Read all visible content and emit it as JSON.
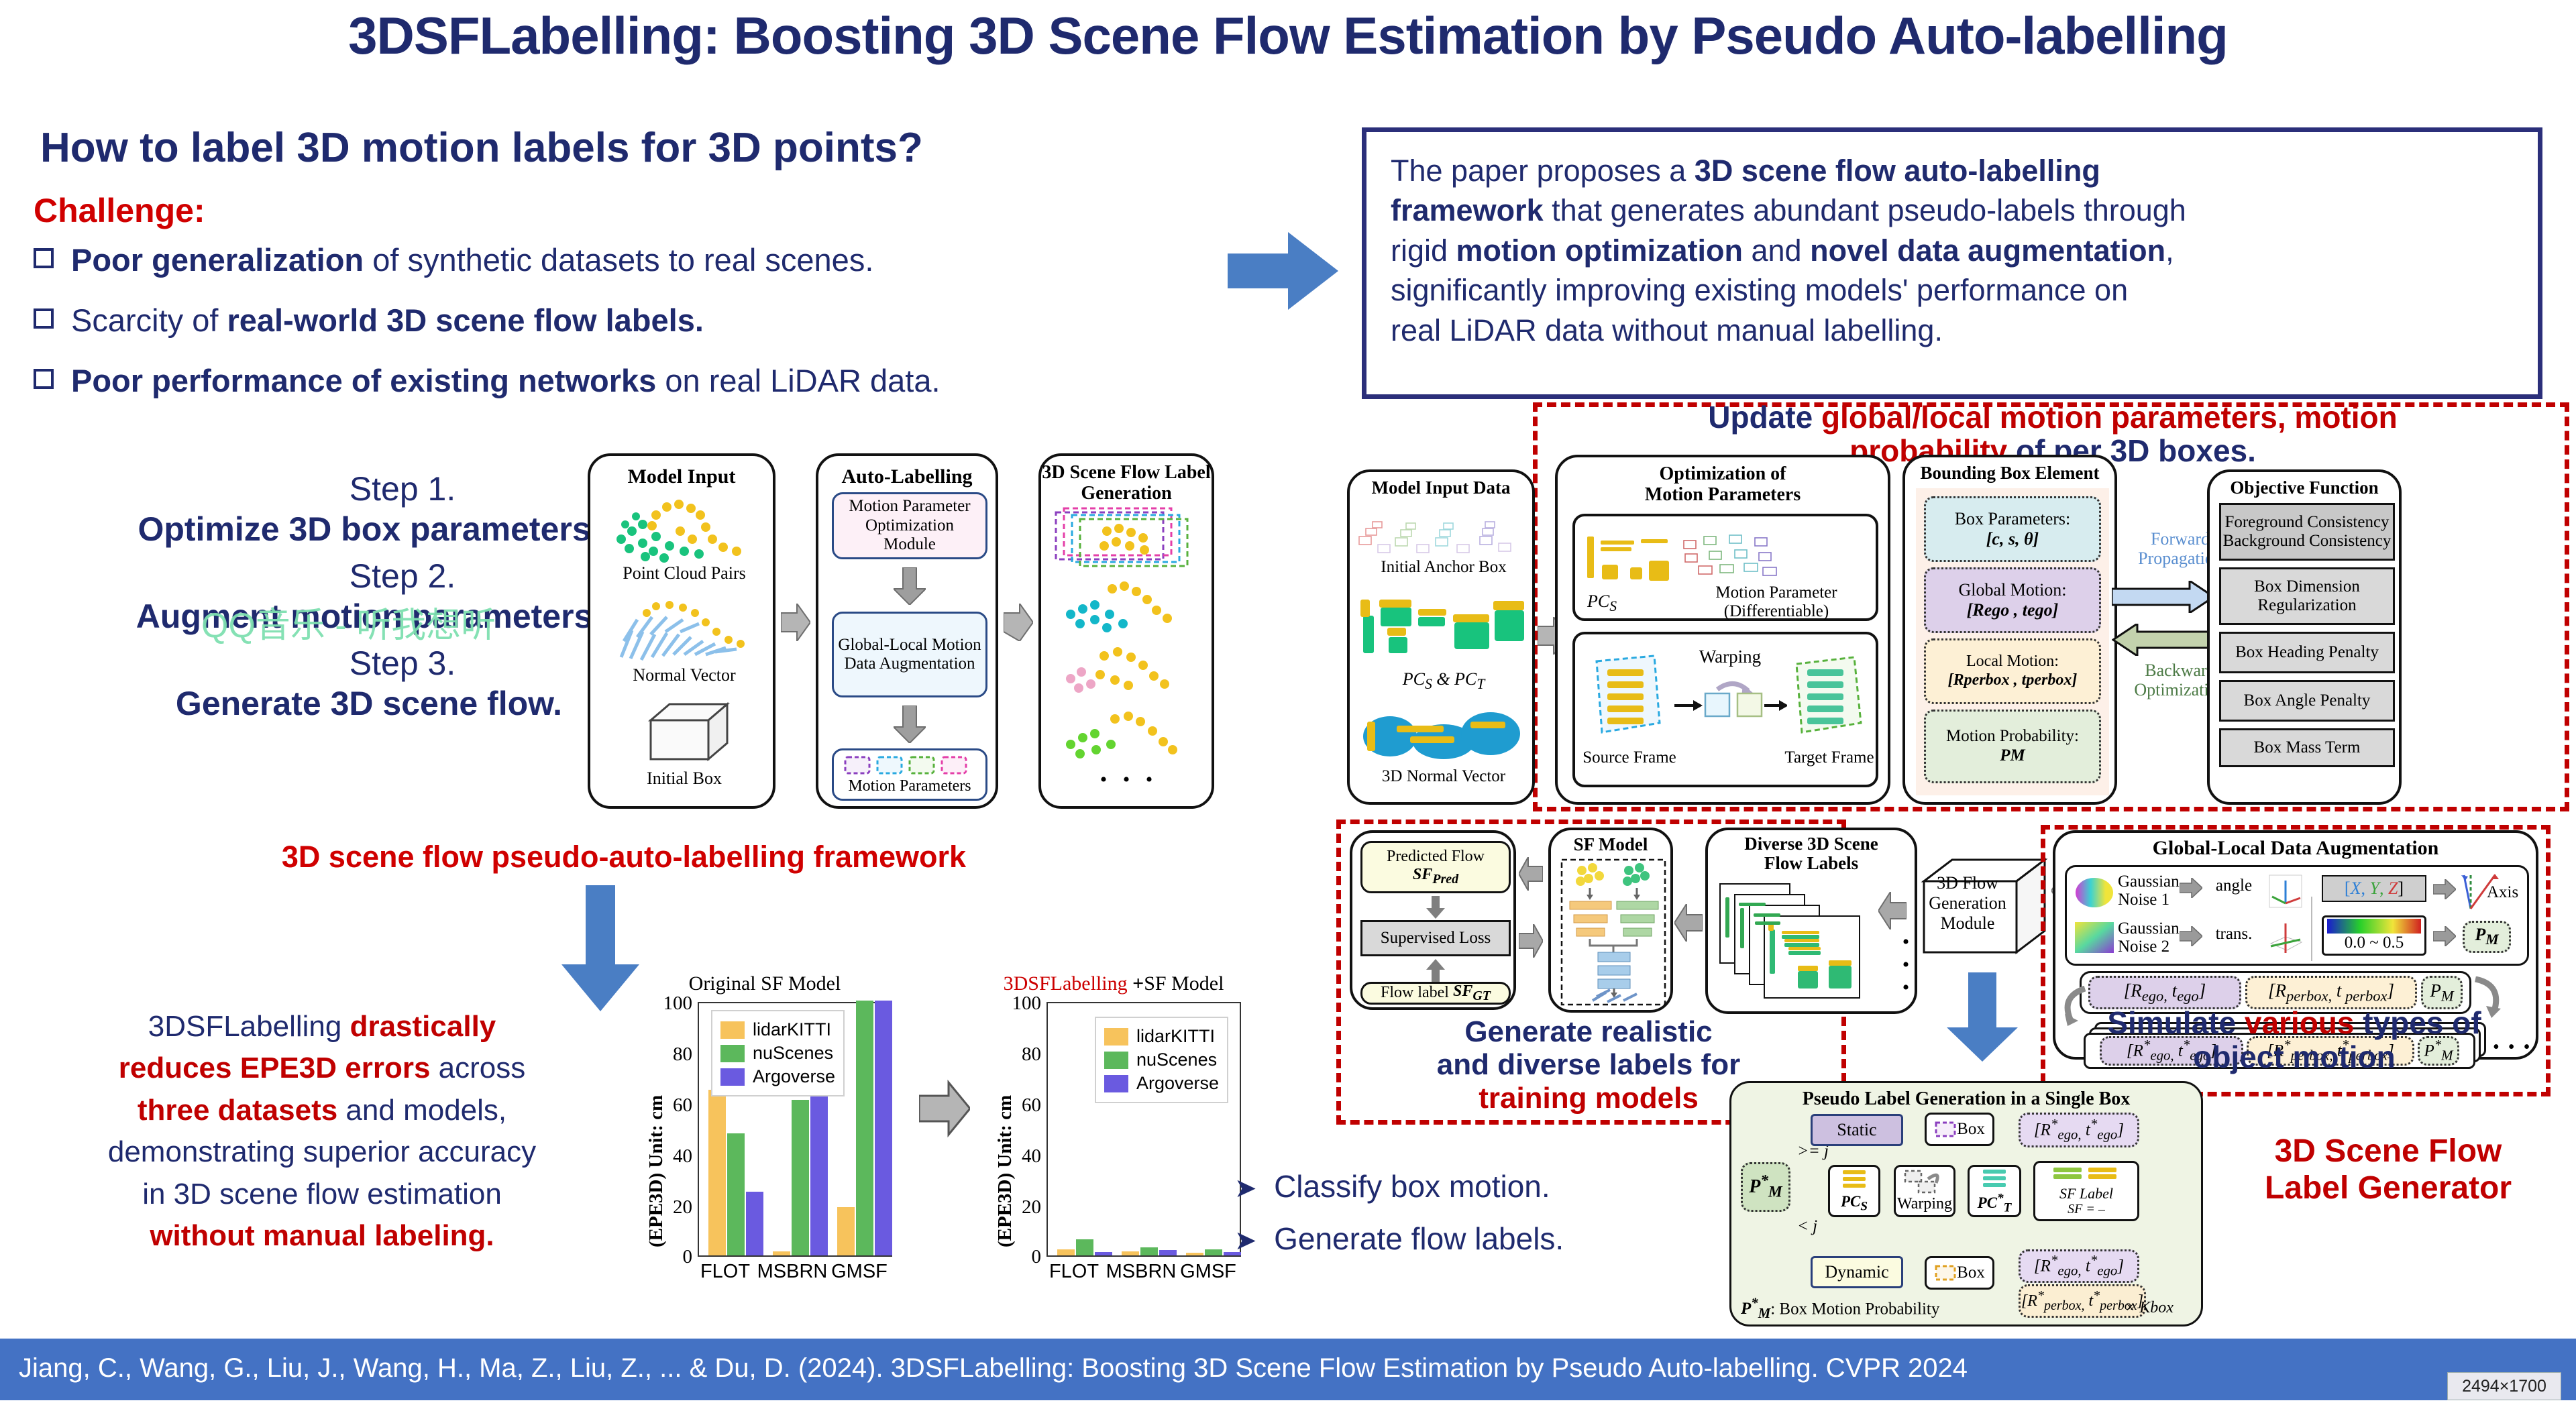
{
  "poster": {
    "title": "3DSFLabelling: Boosting 3D Scene Flow Estimation by Pseudo Auto-labelling",
    "question": "How to label 3D motion labels for 3D points?",
    "challenge_heading": "Challenge:",
    "challenges": [
      {
        "bold": "Poor generalization",
        "rest": " of synthetic datasets to real scenes."
      },
      {
        "bold": "Scarcity of ",
        "rest": "real-world 3D scene flow labels."
      },
      {
        "bold": "Poor performance of existing networks",
        "rest": " on real LiDAR data."
      }
    ],
    "summary": "The paper proposes a 3D scene flow auto-labelling framework that generates abundant pseudo-labels through rigid motion optimization and novel data augmentation, significantly improving existing models' performance on real LiDAR data without manual labelling.",
    "watermark": "QQ音乐 - 听我想听",
    "footer": "Jiang, C., Wang, G., Liu, J., Wang, H., Ma, Z., Liu, Z., ... & Du, D. (2024). 3DSFLabelling: Boosting 3D Scene Flow Estimation by Pseudo Auto-labelling. CVPR 2024",
    "size_badge": "2494×1700"
  },
  "steps": [
    {
      "num": "Step 1.",
      "text": "Optimize 3D box parameters."
    },
    {
      "num": "Step 2.",
      "text": "Augment motion parameters."
    },
    {
      "num": "Step 3.",
      "text": "Generate 3D scene flow."
    }
  ],
  "framework_caption": "3D scene flow pseudo-auto-labelling framework",
  "left_diagram": {
    "panels": [
      {
        "title": "Model Input",
        "captions": [
          "Point Cloud Pairs",
          "Normal Vector",
          "Initial Box"
        ]
      },
      {
        "title": "Auto-Labelling",
        "boxes": [
          "Motion Parameter Optimization Module",
          "Global-Local Motion Data Augmentation"
        ],
        "caption": "Motion Parameters"
      },
      {
        "title": "3D Scene Flow Label Generation",
        "ellipsis": "• • •"
      }
    ]
  },
  "results_text": {
    "l1_a": "3DSFLabelling ",
    "l1_b": "drastically",
    "l2_a": "reduces EPE3D errors",
    "l2_b": " across",
    "l3_a": "three datasets",
    "l3_b": " and models,",
    "l4": "demonstrating superior accuracy",
    "l5": "in 3D scene flow estimation",
    "l6": "without manual labeling."
  },
  "chart_data": [
    {
      "type": "bar",
      "title": "Original SF Model",
      "title_color": "#000000",
      "categories": [
        "FLOT",
        "MSBRN",
        "GMSF"
      ],
      "series": [
        {
          "name": "lidarKITTI",
          "color": "#f7c35c",
          "values": [
            65,
            1.5,
            19
          ]
        },
        {
          "name": "nuScenes",
          "color": "#5aa css",
          "values": [
            48,
            61,
            100
          ]
        },
        {
          "name": "Argoverse",
          "color": "#6a5ae0",
          "values": [
            25,
            71,
            100
          ]
        }
      ],
      "ylabel": "(EPE3D) Unit: cm",
      "yticks": [
        0,
        20,
        40,
        60,
        80,
        100
      ],
      "ylim": [
        0,
        100
      ],
      "legend_position": "upper-left"
    },
    {
      "type": "bar",
      "title_prefix": "3DSFLabelling ",
      "title_plus": "+",
      "title_suffix": "SF Model",
      "title_color": "#cc0000",
      "categories": [
        "FLOT",
        "MSBRN",
        "GMSF"
      ],
      "series": [
        {
          "name": "lidarKITTI",
          "color": "#f7c35c",
          "values": [
            2.2,
            1.6,
            1.1
          ]
        },
        {
          "name": "nuScenes",
          "color": "#5aa css",
          "values": [
            6.2,
            3.0,
            2.2
          ]
        },
        {
          "name": "Argoverse",
          "color": "#6a5ae0",
          "values": [
            1.3,
            1.9,
            1.2
          ]
        }
      ],
      "ylabel": "(EPE3D) Unit: cm",
      "yticks": [
        0,
        20,
        40,
        60,
        80,
        100
      ],
      "ylim": [
        0,
        100
      ],
      "legend_position": "upper-right"
    }
  ],
  "right_diagram": {
    "banner": {
      "w1": "Update ",
      "w2": "global/local motion parameters, motion",
      "w3": "probability",
      "w4": " of per ",
      "w5": "3D boxes."
    },
    "model_input": {
      "title": "Model Input Data",
      "captions": [
        "Initial Anchor Box",
        "PCS & PCT",
        "3D Normal Vector"
      ]
    },
    "optimization": {
      "title_l1": "Optimization of",
      "title_l2": "Motion Parameters",
      "sub1_caption": "PCS",
      "sub1_label_l1": "Motion Parameter",
      "sub1_label_l2": "(Differentiable)",
      "warping": "Warping",
      "source": "Source Frame",
      "target": "Target Frame"
    },
    "bbox_element": {
      "title": "Bounding Box Element",
      "items": [
        {
          "l1": "Box Parameters:",
          "l2": "[c, s, θ]",
          "color": "#d7ecef"
        },
        {
          "l1": "Global Motion:",
          "l2": "[Rego , tego]",
          "color": "#ddd0ea"
        },
        {
          "l1": "Local Motion:",
          "l2": "[Rperbox , tperbox]",
          "color": "#fdf0d5"
        },
        {
          "l1": "Motion Probability:",
          "l2": "PM",
          "color": "#e3eedb"
        }
      ]
    },
    "propagation": {
      "forward_l1": "Forward",
      "forward_l2": "Propagation",
      "backward_l1": "Backward",
      "backward_l2": "Optimization"
    },
    "objective": {
      "title": "Objective Function",
      "items": [
        "Foreground Consistency\nBackground Consistency",
        "Box Dimension\nRegularization",
        "Box Heading Penalty",
        "Box Angle Penalty",
        "Box Mass Term"
      ]
    },
    "training": {
      "pred_l1": "Predicted Flow",
      "pred_l2": "SFPred",
      "loss": "Supervised Loss",
      "gt_l1": "Flow label",
      "gt_l2": "SFGT",
      "sf_model": "SF Model"
    },
    "diverse_labels": {
      "title_l1": "Diverse 3D Scene",
      "title_l2": "Flow Labels",
      "ellipsis": "• • •"
    },
    "flow_gen": {
      "l1": "3D Flow",
      "l2": "Generation",
      "l3": "Module"
    },
    "augmentation": {
      "title": "Global-Local Data Augmentation",
      "noise1_l1": "Gaussian",
      "noise1_l2": "Noise 1",
      "angle": "angle",
      "noise2_l1": "Gaussian",
      "noise2_l2": "Noise 2",
      "trans": "trans.",
      "xyz": "[X, Y, Z]",
      "axis": "Axis",
      "range": "0.0 ~ 0.5",
      "pm": "PM",
      "row1": "[Rego, tego]",
      "row2": "[Rperbox, t perbox]",
      "row3": "PM",
      "star1": "[R*ego, t*ego]",
      "star2": "[R*perbox, t*perbox]",
      "star3": "P*M",
      "ellipsis": "• • •"
    },
    "pseudo": {
      "title": "Pseudo Label Generation in a Single Box",
      "pm": "P*M",
      "ge": ">= j",
      "lt": "< j",
      "static": "Static",
      "dynamic": "Dynamic",
      "box": "Box",
      "pcs": "PCS",
      "warping": "Warping",
      "pct": "PC*T",
      "sf_label_l1": "SF Label",
      "sf_label_l2": "SF =      –",
      "ego": "[R*ego, t*ego]",
      "perbox": "[R*perbox, t*perbox]",
      "legend": "P*M: Box Motion Probability",
      "repeat": "× Kbox"
    },
    "callouts": {
      "generate_l1": "Generate realistic",
      "generate_l2": "and diverse labels for",
      "generate_l3": "training models",
      "simulate_a": "Simulate ",
      "simulate_b": "various",
      "simulate_c": " types of",
      "simulate_d": "object motion"
    },
    "bullets": [
      "Classify box motion.",
      "Generate flow labels."
    ],
    "generator_label_l1": "3D Scene Flow",
    "generator_label_l2": "Label Generator"
  }
}
